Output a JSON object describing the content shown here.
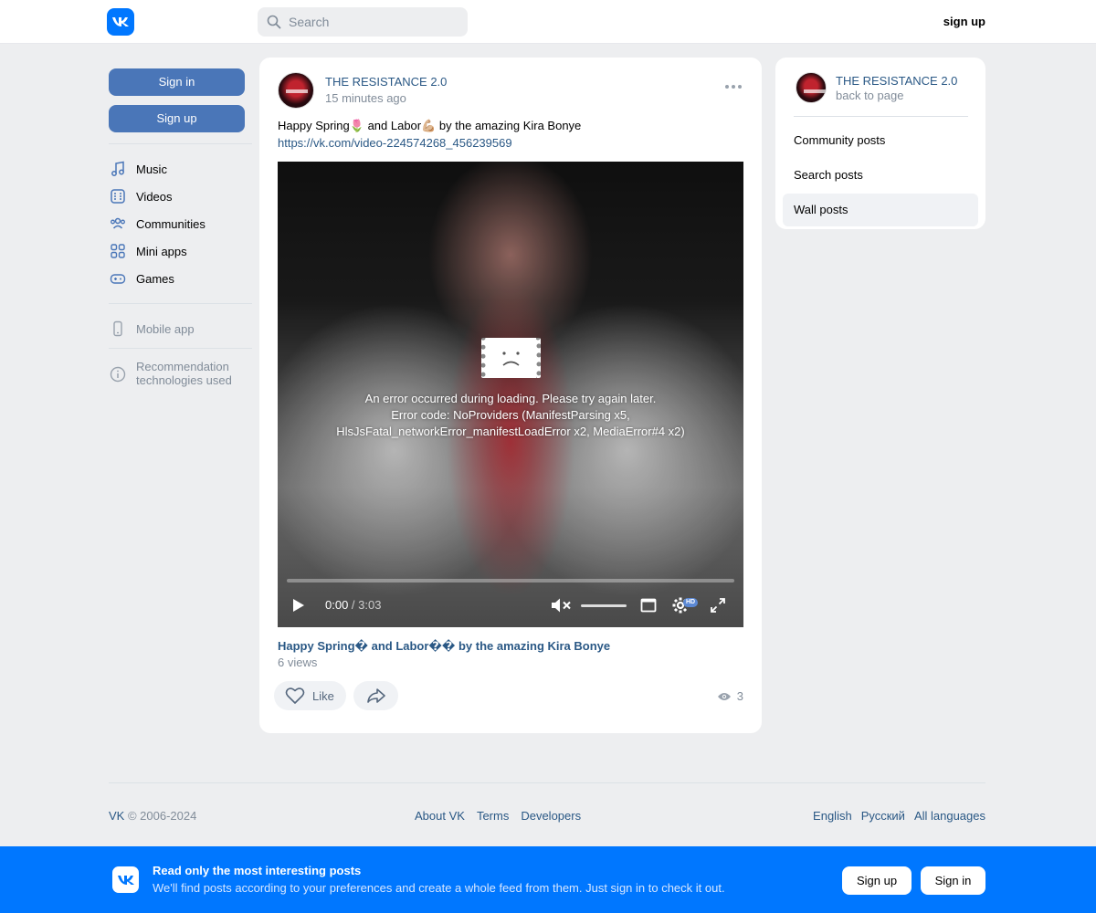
{
  "header": {
    "logo_text": "VK",
    "search_placeholder": "Search",
    "sign_up": "sign up"
  },
  "left": {
    "sign_in": "Sign in",
    "sign_up": "Sign up",
    "nav": [
      {
        "label": "Music",
        "icon": "music-icon"
      },
      {
        "label": "Videos",
        "icon": "videos-icon"
      },
      {
        "label": "Communities",
        "icon": "communities-icon"
      },
      {
        "label": "Mini apps",
        "icon": "mini-apps-icon"
      },
      {
        "label": "Games",
        "icon": "games-icon"
      }
    ],
    "mobile_app": "Mobile app",
    "recommendation": "Recommendation technologies used"
  },
  "post": {
    "author": "THE RESISTANCE 2.0",
    "time": "15 minutes ago",
    "text": "Happy Spring🌷 and Labor💪🏼 by the amazing Kira Bonye",
    "link": "https://vk.com/video-224574268_456239569",
    "video": {
      "error_line1": "An error occurred during loading. Please try again later.",
      "error_line2": "Error code: NoProviders (ManifestParsing x5,",
      "error_line3": "HlsJsFatal_networkError_manifestLoadError x2, MediaError#4 x2)",
      "time_current": "0:00",
      "time_total": " / 3:03",
      "hd_label": "HD",
      "progress": 0
    },
    "video_title": "Happy Spring� and Labor�� by the amazing Kira Bonye",
    "video_views": "6 views",
    "like_label": "Like",
    "view_count": "3"
  },
  "right": {
    "name": "THE RESISTANCE 2.0",
    "back": "back to page",
    "menu": [
      "Community posts",
      "Search posts",
      "Wall posts"
    ],
    "active_index": 2
  },
  "footer": {
    "brand": "VK",
    "copyright": " © 2006-2024",
    "links": [
      "About VK",
      "Terms",
      "Developers"
    ],
    "languages": [
      "English",
      "Русский",
      "All languages"
    ]
  },
  "banner": {
    "title": "Read only the most interesting posts",
    "subtitle": "We'll find posts according to your preferences and create a whole feed from them. Just sign in to check it out.",
    "sign_up": "Sign up",
    "sign_in": "Sign in"
  },
  "colors": {
    "brand": "#0077ff",
    "link": "#2a5885",
    "button": "#4a76b8",
    "background": "#edeef0"
  }
}
